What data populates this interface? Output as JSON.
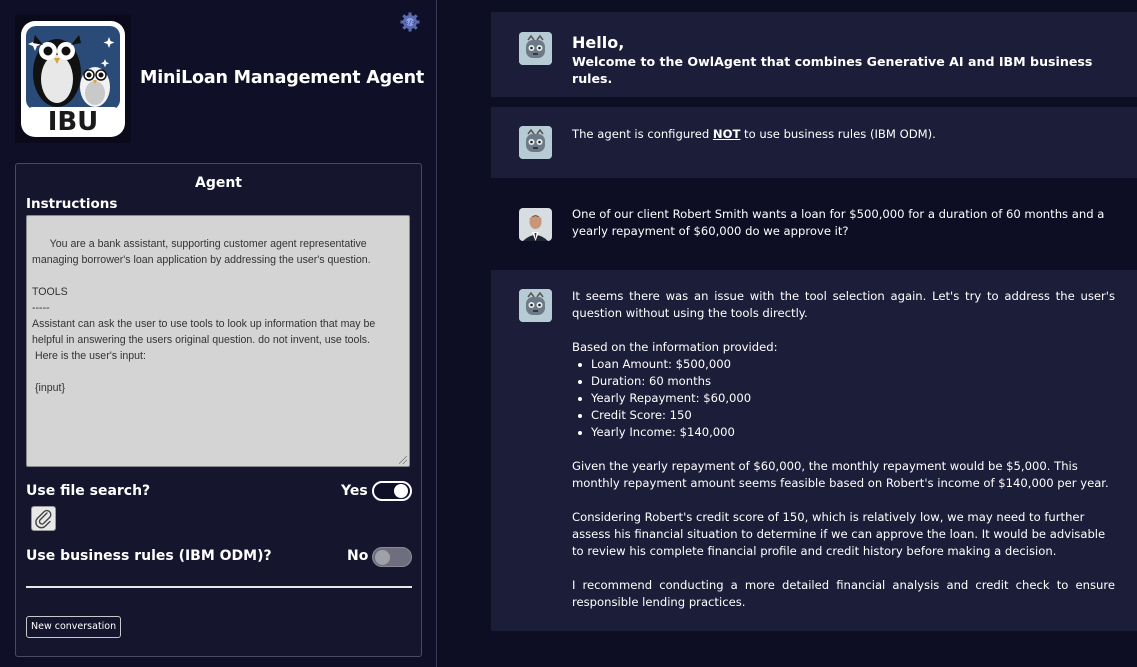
{
  "sidebar": {
    "logo_text": "IBU",
    "app_title": "MiniLoan Management Agent",
    "panel_title": "Agent",
    "instructions_label": "Instructions",
    "instructions_text": "You are a bank assistant, supporting customer agent representative managing borrower's loan application by addressing the user's question.\n\nTOOLS\n-----\nAssistant can ask the user to use tools to look up information that may be helpful in answering the users original question. do not invent, use tools.\n Here is the user's input:\n\n {input}",
    "file_search_label": "Use file search?",
    "file_search_value": "Yes",
    "file_search_enabled": true,
    "business_rules_label": "Use business rules (IBM ODM)?",
    "business_rules_value": "No",
    "business_rules_enabled": false,
    "new_conversation_label": "New conversation"
  },
  "colors": {
    "background": "#0d0d24",
    "message_bg": "#1c1d38",
    "text": "#ffffff"
  },
  "messages": [
    {
      "role": "bot",
      "greeting": "Hello,",
      "text": "Welcome to the OwlAgent that combines Generative AI and IBM business rules."
    },
    {
      "role": "bot",
      "text_before": "The agent is configured ",
      "text_emph": "NOT",
      "text_after": " to use business rules (IBM ODM)."
    },
    {
      "role": "user",
      "text": "One of our client Robert Smith wants a loan for $500,000 for a duration of 60 months and a yearly repayment of $60,000 do we approve it?"
    },
    {
      "role": "bot",
      "intro": "It seems there was an issue with the tool selection again. Let's try to address the user's question without using the tools directly.",
      "list_heading": "Based on the information provided:",
      "items": [
        "Loan Amount: $500,000",
        "Duration: 60 months",
        "Yearly Repayment: $60,000",
        "Credit Score: 150",
        "Yearly Income: $140,000"
      ],
      "para1": "Given the yearly repayment of $60,000, the monthly repayment would be $5,000. This monthly repayment amount seems feasible based on Robert's income of $140,000 per year.",
      "para2": "Considering Robert's credit score of 150, which is relatively low, we may need to further assess his financial situation to determine if we can approve the loan. It would be advisable to review his complete financial profile and credit history before making a decision.",
      "para3": "I recommend conducting a more detailed financial analysis and credit check to ensure responsible lending practices."
    }
  ]
}
